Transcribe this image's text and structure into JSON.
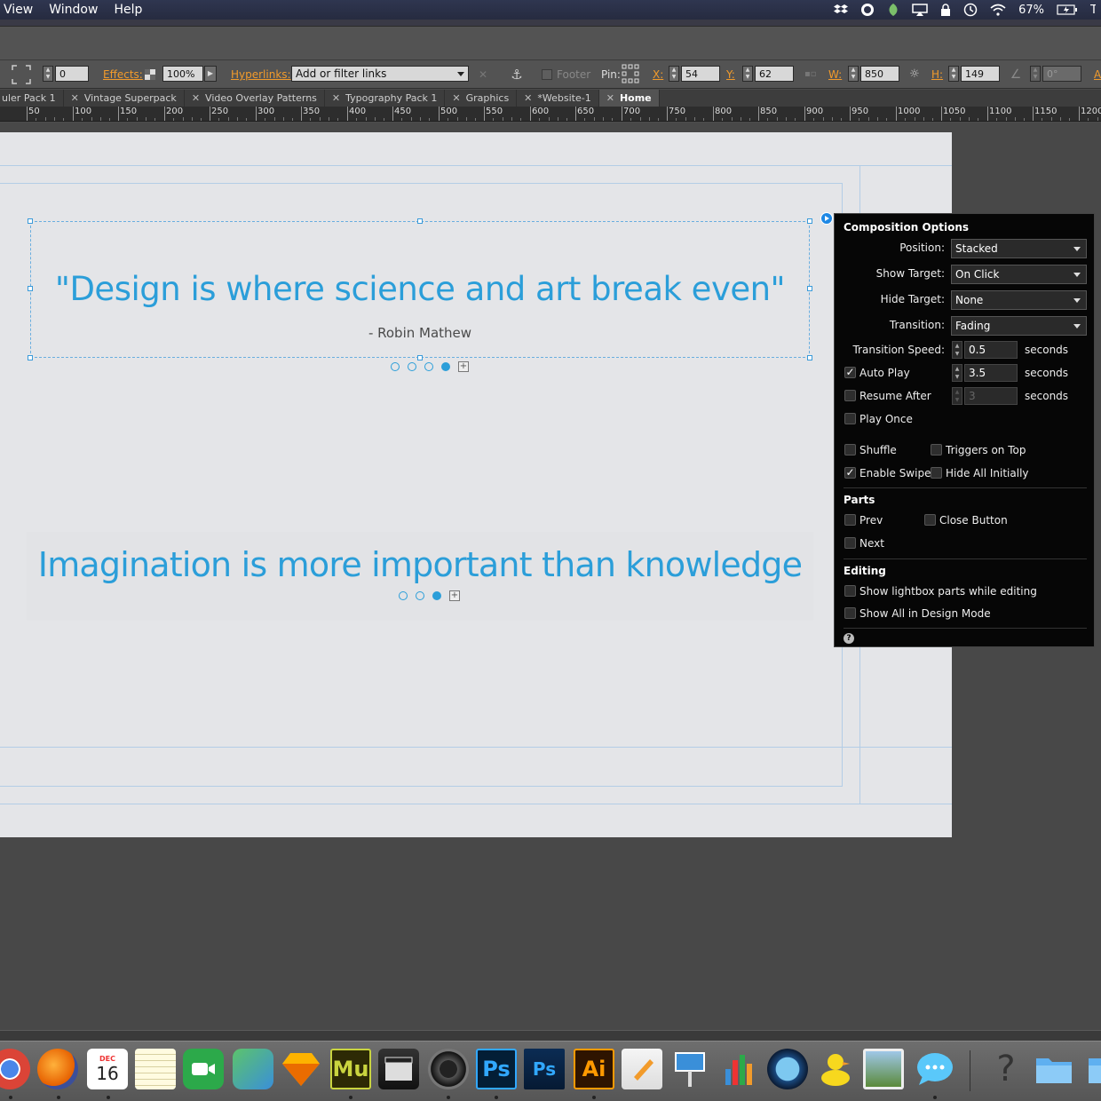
{
  "menubar": {
    "items": [
      "View",
      "Window",
      "Help"
    ],
    "battery": "67%"
  },
  "controlbar": {
    "rotation_value": "0",
    "effects_label": "Effects:",
    "opacity_value": "100%",
    "hyperlinks_label": "Hyperlinks:",
    "hyperlinks_placeholder": "Add or filter links",
    "footer_label": "Footer",
    "pin_label": "Pin:",
    "x_label": "X:",
    "x_value": "54",
    "y_label": "Y:",
    "y_value": "62",
    "w_label": "W:",
    "w_value": "850",
    "h_label": "H:",
    "h_value": "149",
    "angle_value": "0°",
    "extra_label": "A"
  },
  "tabs": [
    {
      "label": "uler Pack 1",
      "closable": false
    },
    {
      "label": "Vintage Superpack",
      "closable": true
    },
    {
      "label": "Video Overlay Patterns",
      "closable": true
    },
    {
      "label": "Typography Pack 1",
      "closable": true
    },
    {
      "label": "Graphics",
      "closable": true
    },
    {
      "label": "*Website-1",
      "closable": true
    },
    {
      "label": "Home",
      "closable": true,
      "active": true
    }
  ],
  "ruler": {
    "labels": [
      "50",
      "100",
      "150",
      "200",
      "250",
      "300",
      "350",
      "400",
      "450",
      "500",
      "550",
      "600",
      "650",
      "700",
      "750",
      "800",
      "850",
      "900",
      "950",
      "1000",
      "1050",
      "1100",
      "1150",
      "1200"
    ]
  },
  "canvas": {
    "quote1": "\"Design is where science and art break even\"",
    "author1": "- Robin Mathew",
    "quote2": "Imagination is more important than knowledge"
  },
  "panel": {
    "title": "Composition Options",
    "position_label": "Position:",
    "position_value": "Stacked",
    "show_target_label": "Show Target:",
    "show_target_value": "On Click",
    "hide_target_label": "Hide Target:",
    "hide_target_value": "None",
    "transition_label": "Transition:",
    "transition_value": "Fading",
    "transition_speed_label": "Transition Speed:",
    "transition_speed_value": "0.5",
    "auto_play_label": "Auto Play",
    "auto_play_value": "3.5",
    "resume_after_label": "Resume After",
    "resume_after_value": "3",
    "seconds": "seconds",
    "play_once_label": "Play Once",
    "shuffle_label": "Shuffle",
    "triggers_on_top_label": "Triggers on Top",
    "enable_swipe_label": "Enable Swipe",
    "hide_all_initially_label": "Hide All Initially",
    "parts_heading": "Parts",
    "prev_label": "Prev",
    "close_button_label": "Close Button",
    "next_label": "Next",
    "editing_heading": "Editing",
    "show_lightbox_label": "Show lightbox parts while editing",
    "show_all_label": "Show All in Design Mode",
    "help_glyph": "?"
  },
  "dock": {
    "calendar_month": "DEC",
    "calendar_day": "16",
    "muse_label": "Mu",
    "ps_label": "Ps",
    "ps2_label": "Ps",
    "ai_label": "Ai",
    "help_glyph": "?"
  }
}
